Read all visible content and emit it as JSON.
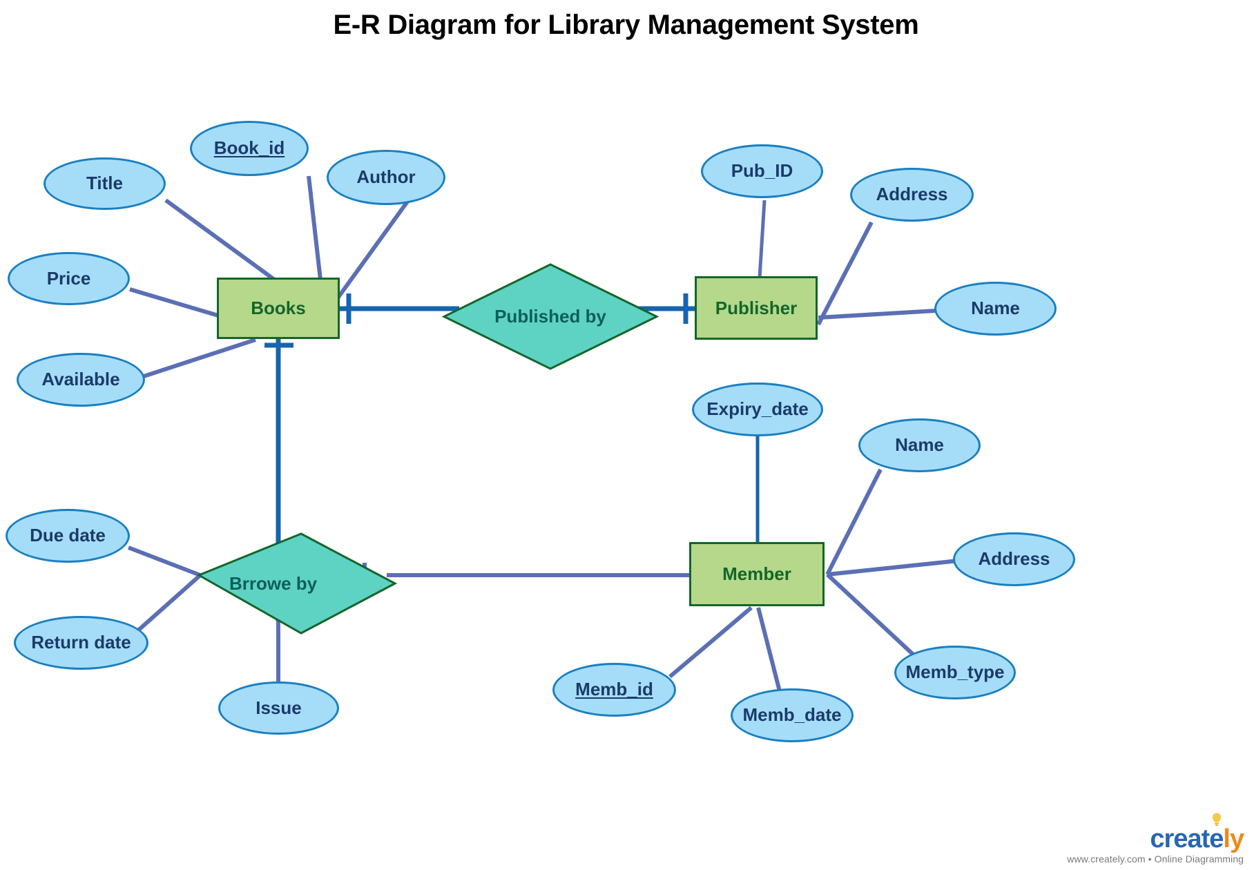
{
  "title": "E-R Diagram for Library Management System",
  "colors": {
    "attribute_fill": "#a5ddf9",
    "attribute_stroke": "#1a7fc1",
    "attribute_text": "#1b3a6b",
    "entity_fill": "#b5d88a",
    "entity_stroke": "#14662a",
    "entity_text": "#14662a",
    "relationship_fill": "#5ed3c4",
    "relationship_stroke": "#14662a",
    "relationship_text": "#0d5f59",
    "connector_purple": "#5b6fb5",
    "connector_blue": "#1565b0",
    "background": "#ffffff",
    "title_text": "#000000"
  },
  "entities": [
    {
      "id": "books",
      "label": "Books"
    },
    {
      "id": "publisher",
      "label": "Publisher"
    },
    {
      "id": "member",
      "label": "Member"
    }
  ],
  "relationships": [
    {
      "id": "published-by",
      "label": "Published by",
      "connects": [
        "Books",
        "Publisher"
      ]
    },
    {
      "id": "brrowe-by",
      "label": "Brrowe by",
      "connects": [
        "Books",
        "Member"
      ]
    }
  ],
  "attributes": [
    {
      "id": "book-id",
      "label": "Book_id",
      "owner": "Books",
      "primary_key": true
    },
    {
      "id": "title",
      "label": "Title",
      "owner": "Books",
      "primary_key": false
    },
    {
      "id": "author",
      "label": "Author",
      "owner": "Books",
      "primary_key": false
    },
    {
      "id": "price",
      "label": "Price",
      "owner": "Books",
      "primary_key": false
    },
    {
      "id": "available",
      "label": "Available",
      "owner": "Books",
      "primary_key": false
    },
    {
      "id": "pub-id",
      "label": "Pub_ID",
      "owner": "Publisher",
      "primary_key": false
    },
    {
      "id": "pub-address",
      "label": "Address",
      "owner": "Publisher",
      "primary_key": false
    },
    {
      "id": "pub-name",
      "label": "Name",
      "owner": "Publisher",
      "primary_key": false
    },
    {
      "id": "expiry-date",
      "label": "Expiry_date",
      "owner": "Member",
      "primary_key": false
    },
    {
      "id": "memb-name",
      "label": "Name",
      "owner": "Member",
      "primary_key": false
    },
    {
      "id": "memb-address",
      "label": "Address",
      "owner": "Member",
      "primary_key": false
    },
    {
      "id": "memb-type",
      "label": "Memb_type",
      "owner": "Member",
      "primary_key": false
    },
    {
      "id": "memb-id",
      "label": "Memb_id",
      "owner": "Member",
      "primary_key": true
    },
    {
      "id": "memb-date",
      "label": "Memb_date",
      "owner": "Member",
      "primary_key": false
    },
    {
      "id": "due-date",
      "label": "Due date",
      "owner": "Brrowe by",
      "primary_key": false
    },
    {
      "id": "return-date",
      "label": "Return date",
      "owner": "Brrowe by",
      "primary_key": false
    },
    {
      "id": "issue",
      "label": "Issue",
      "owner": "Brrowe by",
      "primary_key": false
    }
  ],
  "watermark": {
    "brand_part1": "create",
    "brand_part2": "ly",
    "tagline": "www.creately.com • Online Diagramming"
  }
}
